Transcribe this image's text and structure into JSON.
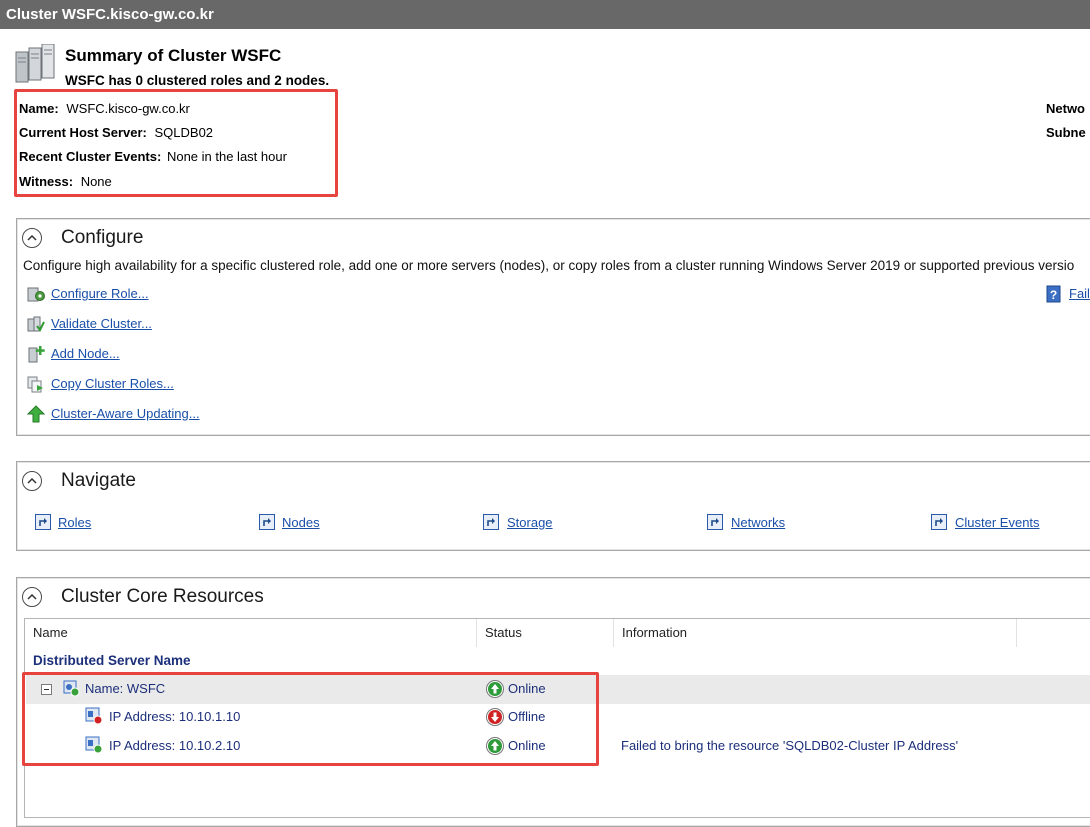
{
  "window": {
    "title": "Cluster WSFC.kisco-gw.co.kr"
  },
  "summary": {
    "title": "Summary of Cluster WSFC",
    "subtitle": "WSFC has 0 clustered roles and 2 nodes.",
    "properties": [
      {
        "label": "Name:",
        "value": "WSFC.kisco-gw.co.kr"
      },
      {
        "label": "Current Host Server:",
        "value": "SQLDB02"
      },
      {
        "label": "Recent Cluster Events:",
        "value": "None in the last hour"
      },
      {
        "label": "Witness:",
        "value": "None"
      }
    ],
    "right_labels": [
      "Netwo",
      "Subne"
    ]
  },
  "configure": {
    "title": "Configure",
    "description": "Configure high availability for a specific clustered role, add one or more servers (nodes), or copy roles from a cluster running Windows Server 2019 or supported previous versio",
    "actions": [
      {
        "label": "Configure Role...",
        "icon": "configure-role-icon"
      },
      {
        "label": "Validate Cluster...",
        "icon": "validate-cluster-icon"
      },
      {
        "label": "Add Node...",
        "icon": "add-node-icon"
      },
      {
        "label": "Copy Cluster Roles...",
        "icon": "copy-roles-icon"
      },
      {
        "label": "Cluster-Aware Updating...",
        "icon": "cluster-aware-updating-icon"
      }
    ],
    "right_link": "Fail"
  },
  "navigate": {
    "title": "Navigate",
    "links": [
      "Roles",
      "Nodes",
      "Storage",
      "Networks",
      "Cluster Events"
    ]
  },
  "core_resources": {
    "title": "Cluster Core Resources",
    "columns": [
      "Name",
      "Status",
      "Information"
    ],
    "group": "Distributed Server Name",
    "rows": [
      {
        "name": "Name: WSFC",
        "status": "Online",
        "info": ""
      },
      {
        "name": "IP Address: 10.10.1.10",
        "status": "Offline",
        "info": ""
      },
      {
        "name": "IP Address: 10.10.2.10",
        "status": "Online",
        "info": "Failed to bring the resource 'SQLDB02-Cluster IP Address'"
      }
    ]
  },
  "colors": {
    "highlight_border": "#e8443f",
    "link": "#1a4fa8",
    "online": "#2e9b3a",
    "offline": "#d02424"
  }
}
